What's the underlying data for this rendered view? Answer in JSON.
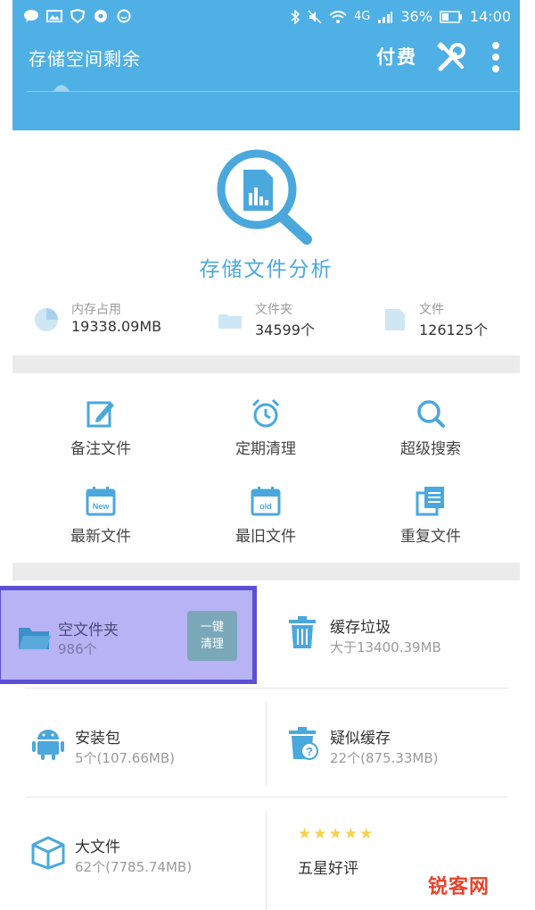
{
  "statusbar": {
    "left_icons": [
      "chat-icon",
      "image-icon",
      "shield-icon",
      "bubble-icon",
      "smile-icon"
    ],
    "network": "4G",
    "battery": "36%",
    "time": "14:00"
  },
  "appbar": {
    "title": "存储空间剩余",
    "pay_label": "付费"
  },
  "analysis": {
    "title": "存储文件分析",
    "stats": [
      {
        "label": "内存占用",
        "value": "19338.09MB"
      },
      {
        "label": "文件夹",
        "value": "34599个"
      },
      {
        "label": "文件",
        "value": "126125个"
      }
    ]
  },
  "tools": [
    {
      "label": "备注文件"
    },
    {
      "label": "定期清理"
    },
    {
      "label": "超级搜索"
    },
    {
      "label": "最新文件",
      "badge": "New"
    },
    {
      "label": "最旧文件",
      "badge": "old"
    },
    {
      "label": "重复文件"
    }
  ],
  "clean": {
    "empty_folder": {
      "title": "空文件夹",
      "sub": "986个",
      "button_line1": "一键",
      "button_line2": "清理"
    },
    "cache": {
      "title": "缓存垃圾",
      "sub": "大于13400.39MB"
    },
    "apk": {
      "title": "安装包",
      "sub": "5个(107.66MB)"
    },
    "suspect_cache": {
      "title": "疑似缓存",
      "sub": "22个(875.33MB)"
    },
    "big_file": {
      "title": "大文件",
      "sub": "62个(7785.74MB)"
    },
    "rating": {
      "title": "五星好评",
      "stars": 5
    }
  },
  "watermark": {
    "text": "锐客网"
  },
  "colors": {
    "primary": "#4fb0e5",
    "highlight_bg": "#b7b3f5",
    "highlight_border": "#5b4fd6",
    "star": "#f5d34a",
    "watermark": "#e8432b"
  }
}
